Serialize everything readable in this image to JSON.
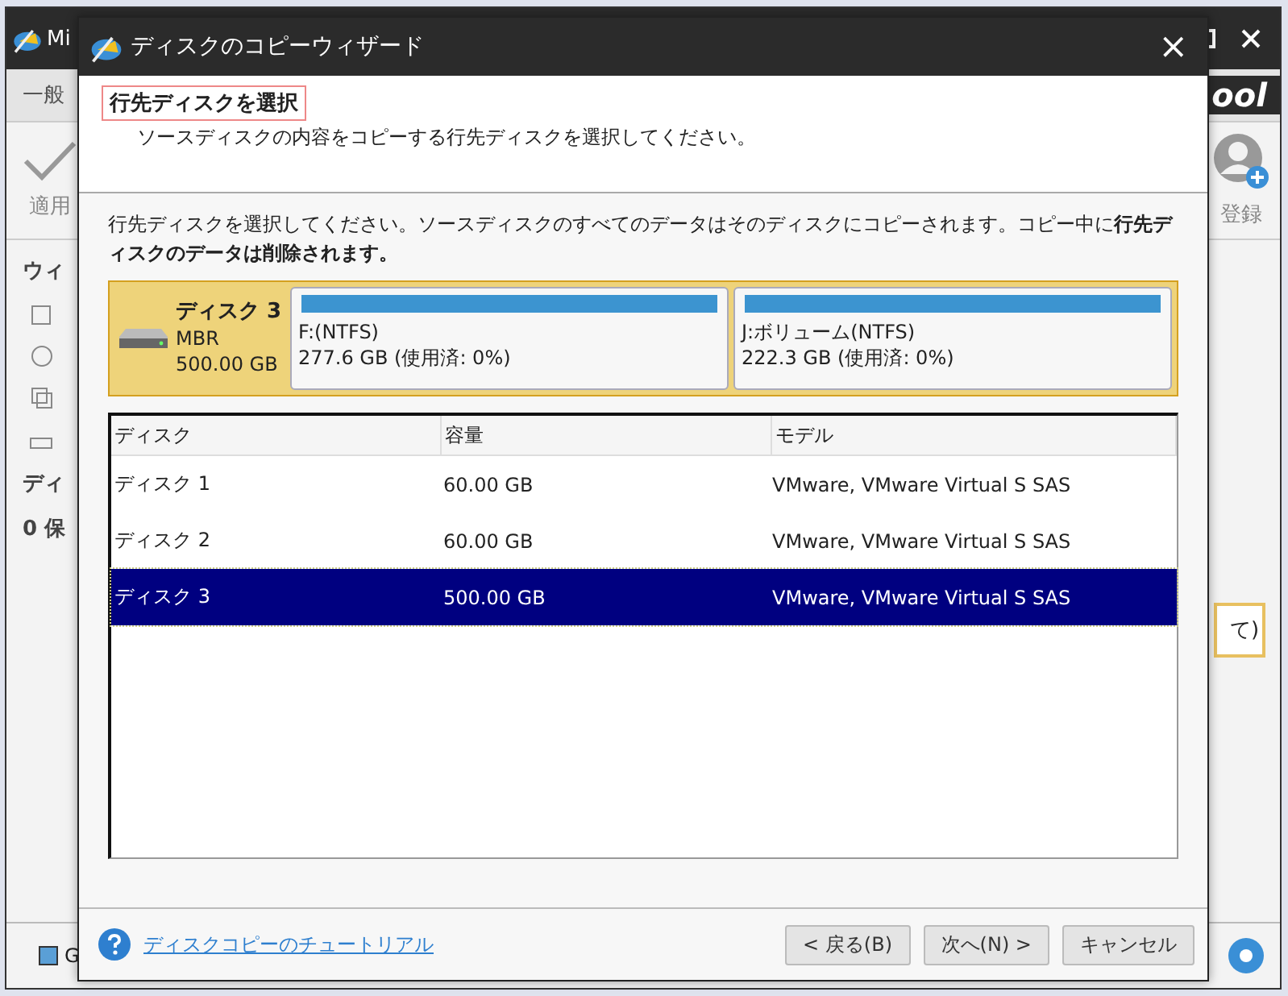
{
  "background_app": {
    "title": "Mi",
    "tab": "一般",
    "apply_label": "適用",
    "brand": "ool",
    "register_label": "登録",
    "sidebar_heading_1": "ウィ",
    "sidebar_heading_2": "ディ",
    "sidebar_status": "0 保",
    "panel_text": "て)",
    "legend_label": "G"
  },
  "dialog": {
    "title": "ディスクのコピーウィザード",
    "close": "×",
    "heading": "行先ディスクを選択",
    "subheading": "ソースディスクの内容をコピーする行先ディスクを選択してください。",
    "instruction": "行先ディスクを選択してください。ソースディスクのすべてのデータはそのディスクにコピーされます。コピー中に**行先ディスクのデータは削除されます。**",
    "disk_map": {
      "name": "ディスク 3",
      "type": "MBR",
      "size": "500.00 GB",
      "partitions": [
        {
          "label": "F:(NTFS)",
          "info": "277.6 GB (使用済: 0%)"
        },
        {
          "label": "J:ボリューム(NTFS)",
          "info": "222.3 GB (使用済: 0%)"
        }
      ]
    },
    "table": {
      "columns": [
        "ディスク",
        "容量",
        "モデル"
      ],
      "rows": [
        {
          "cells": [
            "ディスク 1",
            "60.00 GB",
            "VMware, VMware Virtual S SAS"
          ],
          "selected": false
        },
        {
          "cells": [
            "ディスク 2",
            "60.00 GB",
            "VMware, VMware Virtual S SAS"
          ],
          "selected": false
        },
        {
          "cells": [
            "ディスク 3",
            "500.00 GB",
            "VMware, VMware Virtual S SAS"
          ],
          "selected": true
        }
      ]
    },
    "tutorial_link": "ディスクコピーのチュートリアル",
    "buttons": [
      "< 戻る(B)",
      "次へ(N) >",
      "キャンセル"
    ]
  }
}
